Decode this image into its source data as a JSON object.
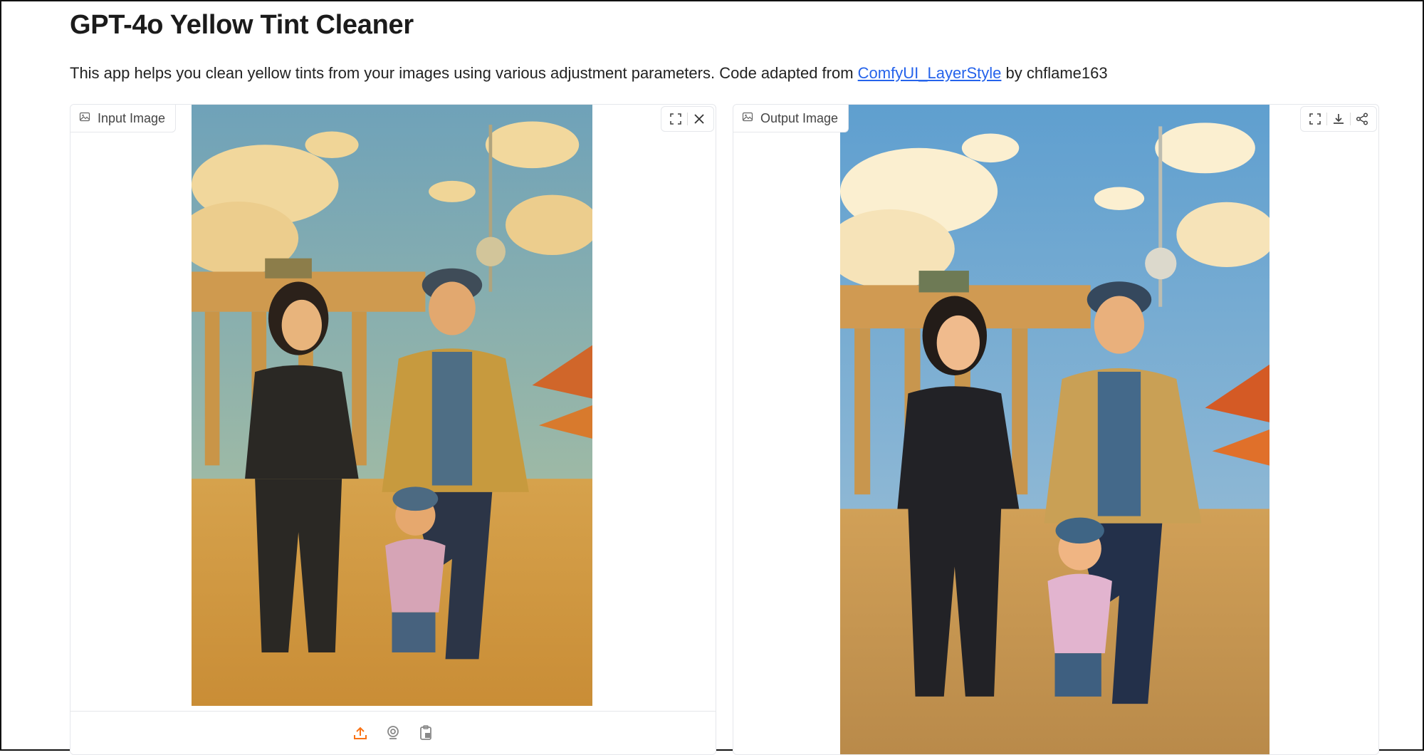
{
  "app": {
    "title": "GPT-4o Yellow Tint Cleaner",
    "description_prefix": "This app helps you clean yellow tints from your images using various adjustment parameters. Code adapted from ",
    "link_text": "ComfyUI_LayerStyle",
    "description_suffix": " by chflame163"
  },
  "input_panel": {
    "label": "Input Image",
    "icon": "image-icon",
    "tools": [
      "fullscreen-icon",
      "close-icon"
    ],
    "sources": [
      "upload-icon",
      "webcam-icon",
      "clipboard-icon"
    ],
    "image_tint": "yellow"
  },
  "output_panel": {
    "label": "Output Image",
    "icon": "image-icon",
    "tools": [
      "fullscreen-icon",
      "download-icon",
      "share-icon"
    ],
    "image_tint": "neutral"
  },
  "colors": {
    "accent": "#f97316",
    "link": "#2563eb",
    "border": "#e5e7eb"
  }
}
